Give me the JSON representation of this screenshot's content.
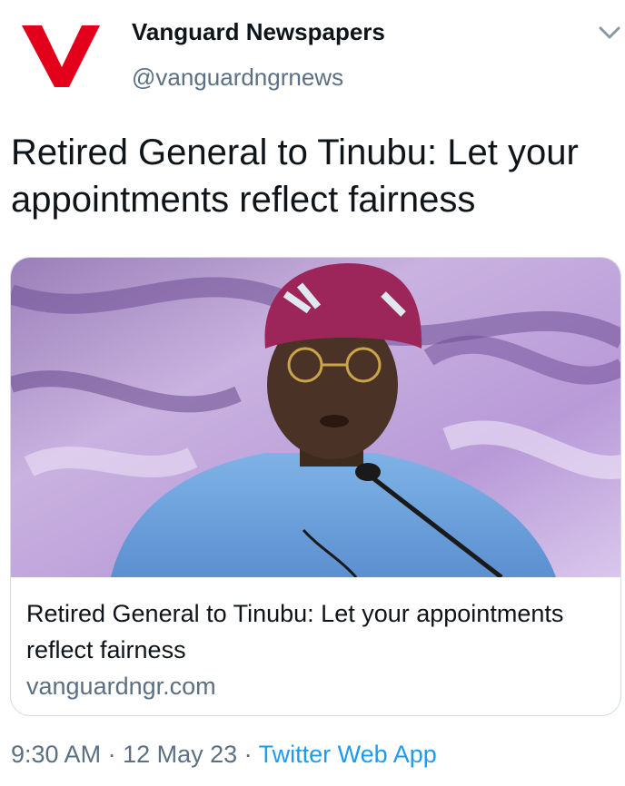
{
  "account": {
    "name": "Vanguard Newspapers",
    "handle": "@vanguardngrnews",
    "logo_letter": "V",
    "logo_color": "#e3001b"
  },
  "tweet": {
    "text": "Retired General to Tinubu: Let your appointments reflect fairness"
  },
  "card": {
    "title": "Retired General to Tinubu: Let your appointments reflect fairness",
    "domain": "vanguardngr.com"
  },
  "meta": {
    "time": "9:30 AM",
    "separator": " · ",
    "date": "12 May 23",
    "source": "Twitter Web App"
  },
  "icons": {
    "more": "chevron-down-icon"
  },
  "colors": {
    "secondary_text": "#5b7083",
    "link": "#1d9bf0",
    "card_border": "#d4dbe1"
  }
}
